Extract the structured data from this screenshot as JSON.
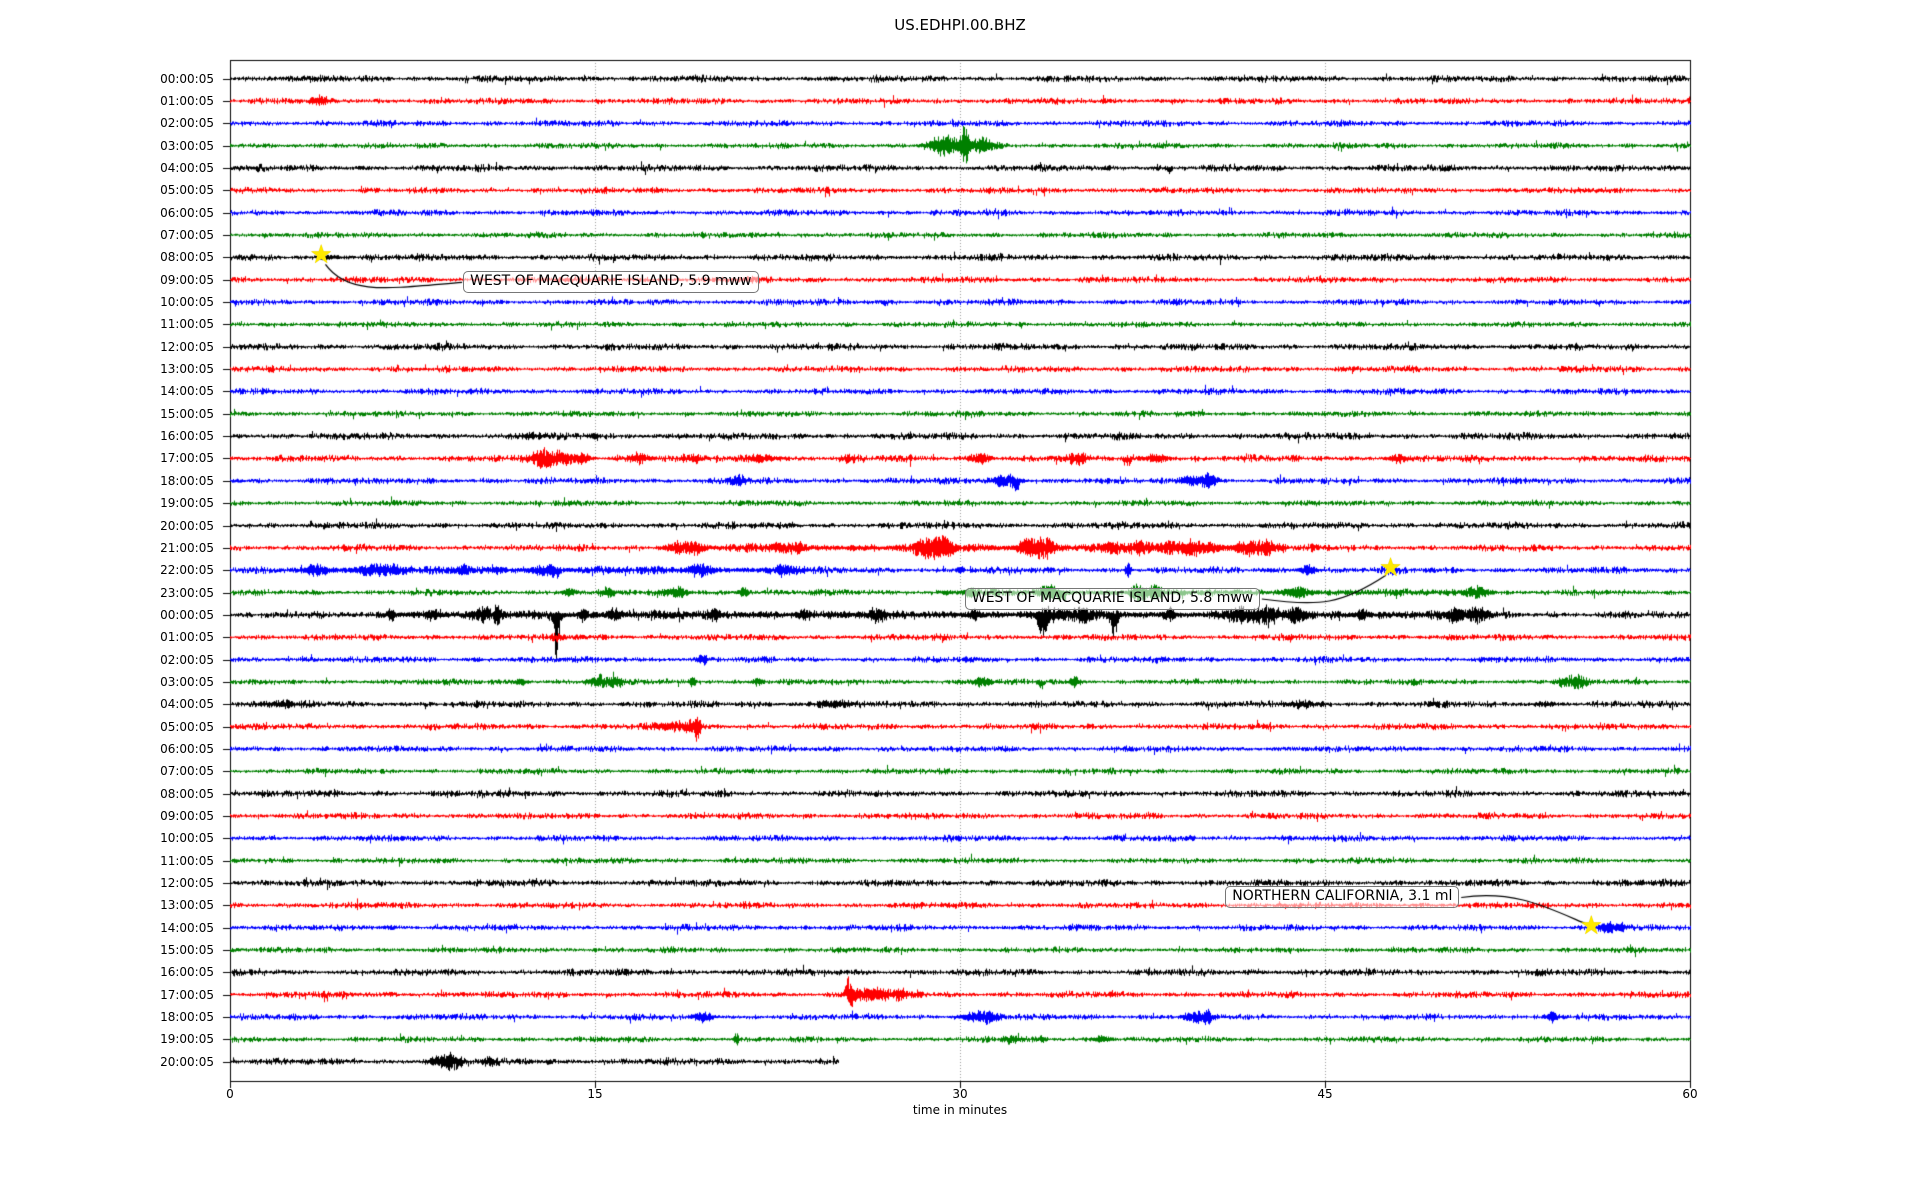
{
  "header": {
    "title": "US.EDHPI.00.BHZ"
  },
  "chart_data": {
    "type": "line",
    "subtype": "seismogram_dayplot",
    "title": "US.EDHPI.00.BHZ",
    "xlabel": "time in minutes",
    "x_axis": {
      "label": "time in minutes",
      "ticks": [
        0,
        15,
        30,
        45,
        60
      ],
      "range": [
        0,
        60
      ],
      "gridlines_at": [
        15,
        30,
        45
      ],
      "grid_style": "dotted"
    },
    "legend": "none",
    "trace_color_cycle": [
      "#000000",
      "#ff0000",
      "#0000ff",
      "#008000"
    ],
    "grid_color": "#9a9a9a",
    "marker_color": "#ffe900",
    "rows": [
      {
        "label": "00:00:05",
        "color": "#000000",
        "noise": 2.8,
        "events": []
      },
      {
        "label": "01:00:05",
        "color": "#ff0000",
        "noise": 2.6,
        "events": [
          {
            "t": 3.7,
            "d": 0.25,
            "a": 3.5
          }
        ]
      },
      {
        "label": "02:00:05",
        "color": "#0000ff",
        "noise": 2.6,
        "events": []
      },
      {
        "label": "03:00:05",
        "color": "#008000",
        "noise": 2.4,
        "events": [
          {
            "t": 29.4,
            "d": 0.45,
            "a": 9
          },
          {
            "t": 30.2,
            "d": 0.12,
            "a": 21
          },
          {
            "t": 30.9,
            "d": 0.3,
            "a": 8
          }
        ]
      },
      {
        "label": "04:00:05",
        "color": "#000000",
        "noise": 2.8,
        "events": [
          {
            "t": 38.6,
            "d": 0.06,
            "a": 8,
            "dir": -1
          }
        ]
      },
      {
        "label": "05:00:05",
        "color": "#ff0000",
        "noise": 2.6,
        "events": []
      },
      {
        "label": "06:00:05",
        "color": "#0000ff",
        "noise": 2.6,
        "events": []
      },
      {
        "label": "07:00:05",
        "color": "#008000",
        "noise": 2.4,
        "events": []
      },
      {
        "label": "08:00:05",
        "color": "#000000",
        "noise": 2.9,
        "events": [
          {
            "t": 4.1,
            "d": 0.3,
            "a": 1.5
          }
        ]
      },
      {
        "label": "09:00:05",
        "color": "#ff0000",
        "noise": 2.7,
        "events": []
      },
      {
        "label": "10:00:05",
        "color": "#0000ff",
        "noise": 2.6,
        "events": [
          {
            "t": 26.9,
            "d": 0.07,
            "a": 6,
            "dir": -1
          }
        ]
      },
      {
        "label": "11:00:05",
        "color": "#008000",
        "noise": 2.4,
        "events": []
      },
      {
        "label": "12:00:05",
        "color": "#000000",
        "noise": 2.9,
        "events": []
      },
      {
        "label": "13:00:05",
        "color": "#ff0000",
        "noise": 2.7,
        "events": []
      },
      {
        "label": "14:00:05",
        "color": "#0000ff",
        "noise": 2.6,
        "events": []
      },
      {
        "label": "15:00:05",
        "color": "#008000",
        "noise": 2.4,
        "events": []
      },
      {
        "label": "16:00:05",
        "color": "#000000",
        "noise": 3.0,
        "events": [
          {
            "t": 12.4,
            "d": 0.3,
            "a": 2
          },
          {
            "t": 15.0,
            "d": 0.1,
            "a": 4
          }
        ]
      },
      {
        "label": "17:00:05",
        "color": "#ff0000",
        "noise": 2.9,
        "events": [
          {
            "t": 12.8,
            "d": 0.35,
            "a": 8
          },
          {
            "t": 13.6,
            "d": 0.4,
            "a": 6
          },
          {
            "t": 14.5,
            "d": 0.2,
            "a": 5
          },
          {
            "t": 16.8,
            "d": 0.35,
            "a": 4
          },
          {
            "t": 19.0,
            "d": 0.3,
            "a": 3
          },
          {
            "t": 21.8,
            "d": 0.4,
            "a": 4
          },
          {
            "t": 25.4,
            "d": 0.2,
            "a": 3
          },
          {
            "t": 30.8,
            "d": 0.3,
            "a": 5
          },
          {
            "t": 34.8,
            "d": 0.3,
            "a": 4
          },
          {
            "t": 36.9,
            "d": 0.1,
            "a": 7,
            "dir": -1
          },
          {
            "t": 38.1,
            "d": 0.3,
            "a": 4
          },
          {
            "t": 48.0,
            "d": 0.25,
            "a": 4
          }
        ]
      },
      {
        "label": "18:00:05",
        "color": "#0000ff",
        "noise": 2.7,
        "events": [
          {
            "t": 20.8,
            "d": 0.25,
            "a": 5
          },
          {
            "t": 31.9,
            "d": 0.35,
            "a": 6
          },
          {
            "t": 32.3,
            "d": 0.1,
            "a": 8,
            "dir": -1
          },
          {
            "t": 39.5,
            "d": 0.3,
            "a": 5
          },
          {
            "t": 40.2,
            "d": 0.25,
            "a": 7
          }
        ]
      },
      {
        "label": "19:00:05",
        "color": "#008000",
        "noise": 2.4,
        "events": []
      },
      {
        "label": "20:00:05",
        "color": "#000000",
        "noise": 2.9,
        "events": []
      },
      {
        "label": "21:00:05",
        "color": "#ff0000",
        "noise": 2.9,
        "bands": [
          {
            "t0": 17.5,
            "t1": 43.5,
            "a": 1.2
          }
        ],
        "events": [
          {
            "t": 18.4,
            "d": 0.3,
            "a": 5
          },
          {
            "t": 19.1,
            "d": 0.2,
            "a": 4
          },
          {
            "t": 22.6,
            "d": 0.3,
            "a": 4
          },
          {
            "t": 23.3,
            "d": 0.15,
            "a": 5
          },
          {
            "t": 28.6,
            "d": 0.35,
            "a": 8
          },
          {
            "t": 29.3,
            "d": 0.3,
            "a": 10
          },
          {
            "t": 32.8,
            "d": 0.3,
            "a": 8
          },
          {
            "t": 33.5,
            "d": 0.3,
            "a": 9
          },
          {
            "t": 36.2,
            "d": 0.3,
            "a": 4
          },
          {
            "t": 37.3,
            "d": 0.35,
            "a": 5
          },
          {
            "t": 38.6,
            "d": 0.35,
            "a": 5
          },
          {
            "t": 39.5,
            "d": 0.35,
            "a": 6
          },
          {
            "t": 40.3,
            "d": 0.3,
            "a": 4
          },
          {
            "t": 41.8,
            "d": 0.35,
            "a": 6
          },
          {
            "t": 42.6,
            "d": 0.3,
            "a": 5
          }
        ]
      },
      {
        "label": "22:00:05",
        "color": "#0000ff",
        "noise": 2.8,
        "bands": [
          {
            "t0": 2.5,
            "t1": 24.0,
            "a": 1.0
          }
        ],
        "events": [
          {
            "t": 3.6,
            "d": 0.3,
            "a": 4
          },
          {
            "t": 5.8,
            "d": 0.45,
            "a": 5
          },
          {
            "t": 6.7,
            "d": 0.3,
            "a": 4
          },
          {
            "t": 9.6,
            "d": 0.2,
            "a": 4
          },
          {
            "t": 11.0,
            "d": 0.15,
            "a": 3
          },
          {
            "t": 12.9,
            "d": 0.35,
            "a": 5
          },
          {
            "t": 13.4,
            "d": 0.1,
            "a": 7,
            "dir": -1
          },
          {
            "t": 19.3,
            "d": 0.35,
            "a": 6
          },
          {
            "t": 22.8,
            "d": 0.3,
            "a": 4
          },
          {
            "t": 30.0,
            "d": 0.1,
            "a": 3
          },
          {
            "t": 36.9,
            "d": 0.08,
            "a": 9
          },
          {
            "t": 44.3,
            "d": 0.25,
            "a": 5
          },
          {
            "t": 47.8,
            "d": 0.15,
            "a": 3
          }
        ]
      },
      {
        "label": "23:00:05",
        "color": "#008000",
        "noise": 2.6,
        "bands": [
          {
            "t0": 29.0,
            "t1": 52.0,
            "a": 0.8
          }
        ],
        "events": [
          {
            "t": 13.9,
            "d": 0.2,
            "a": 4
          },
          {
            "t": 15.5,
            "d": 0.2,
            "a": 4
          },
          {
            "t": 18.3,
            "d": 0.35,
            "a": 5
          },
          {
            "t": 21.1,
            "d": 0.15,
            "a": 5
          },
          {
            "t": 30.5,
            "d": 0.2,
            "a": 4
          },
          {
            "t": 33.6,
            "d": 0.25,
            "a": 7
          },
          {
            "t": 34.2,
            "d": 0.15,
            "a": 9,
            "dir": -1
          },
          {
            "t": 37.3,
            "d": 0.25,
            "a": 8
          },
          {
            "t": 38.0,
            "d": 0.2,
            "a": 6
          },
          {
            "t": 43.9,
            "d": 0.35,
            "a": 5
          },
          {
            "t": 51.2,
            "d": 0.3,
            "a": 6
          }
        ]
      },
      {
        "label": "00:00:05",
        "color": "#000000",
        "noise": 3.1,
        "bands": [
          {
            "t0": 6.0,
            "t1": 52.0,
            "a": 1.3
          }
        ],
        "events": [
          {
            "t": 6.6,
            "d": 0.08,
            "a": 7
          },
          {
            "t": 8.3,
            "d": 0.2,
            "a": 4
          },
          {
            "t": 10.4,
            "d": 0.3,
            "a": 5
          },
          {
            "t": 11.0,
            "d": 0.1,
            "a": 8
          },
          {
            "t": 13.4,
            "d": 0.1,
            "a": 45,
            "dir": -1
          },
          {
            "t": 14.5,
            "d": 0.1,
            "a": 6
          },
          {
            "t": 15.8,
            "d": 0.2,
            "a": 5
          },
          {
            "t": 19.9,
            "d": 0.1,
            "a": 5
          },
          {
            "t": 23.6,
            "d": 0.2,
            "a": 4
          },
          {
            "t": 26.6,
            "d": 0.2,
            "a": 4
          },
          {
            "t": 30.6,
            "d": 0.15,
            "a": 5
          },
          {
            "t": 33.4,
            "d": 0.15,
            "a": 20,
            "dir": -1
          },
          {
            "t": 33.8,
            "d": 0.4,
            "a": 5
          },
          {
            "t": 35.0,
            "d": 0.3,
            "a": 6
          },
          {
            "t": 36.3,
            "d": 0.1,
            "a": 25,
            "dir": -1
          },
          {
            "t": 38.6,
            "d": 0.15,
            "a": 6
          },
          {
            "t": 41.5,
            "d": 0.4,
            "a": 6
          },
          {
            "t": 42.5,
            "d": 0.4,
            "a": 7
          },
          {
            "t": 43.8,
            "d": 0.3,
            "a": 6
          },
          {
            "t": 46.5,
            "d": 0.15,
            "a": 5
          },
          {
            "t": 50.3,
            "d": 0.3,
            "a": 5
          },
          {
            "t": 51.2,
            "d": 0.3,
            "a": 6
          }
        ]
      },
      {
        "label": "01:00:05",
        "color": "#ff0000",
        "noise": 2.7,
        "events": [
          {
            "t": 13.5,
            "d": 0.15,
            "a": 3
          }
        ]
      },
      {
        "label": "02:00:05",
        "color": "#0000ff",
        "noise": 2.6,
        "events": [
          {
            "t": 19.4,
            "d": 0.12,
            "a": 6
          }
        ]
      },
      {
        "label": "03:00:05",
        "color": "#008000",
        "noise": 2.5,
        "events": [
          {
            "t": 11.9,
            "d": 0.2,
            "a": 3
          },
          {
            "t": 15.2,
            "d": 0.3,
            "a": 6
          },
          {
            "t": 15.9,
            "d": 0.15,
            "a": 5
          },
          {
            "t": 19.0,
            "d": 0.08,
            "a": 6
          },
          {
            "t": 21.7,
            "d": 0.15,
            "a": 4
          },
          {
            "t": 30.9,
            "d": 0.25,
            "a": 4
          },
          {
            "t": 33.3,
            "d": 0.08,
            "a": 12,
            "dir": -1
          },
          {
            "t": 34.7,
            "d": 0.15,
            "a": 4
          },
          {
            "t": 54.9,
            "d": 0.3,
            "a": 4
          },
          {
            "t": 55.4,
            "d": 0.2,
            "a": 5
          }
        ]
      },
      {
        "label": "04:00:05",
        "color": "#000000",
        "noise": 2.9,
        "events": [
          {
            "t": 2.0,
            "d": 0.6,
            "a": 2.2
          },
          {
            "t": 24.8,
            "d": 0.5,
            "a": 3
          },
          {
            "t": 44.0,
            "d": 0.35,
            "a": 2.5
          },
          {
            "t": 54.0,
            "d": 0.3,
            "a": 1.5
          }
        ]
      },
      {
        "label": "05:00:05",
        "color": "#ff0000",
        "noise": 2.7,
        "events": [
          {
            "t": 18.1,
            "d": 0.5,
            "a": 3.5
          },
          {
            "t": 18.9,
            "d": 0.25,
            "a": 5
          },
          {
            "t": 19.2,
            "d": 0.07,
            "a": 15
          }
        ]
      },
      {
        "label": "06:00:05",
        "color": "#0000ff",
        "noise": 2.6,
        "events": []
      },
      {
        "label": "07:00:05",
        "color": "#008000",
        "noise": 2.4,
        "events": []
      },
      {
        "label": "08:00:05",
        "color": "#000000",
        "noise": 2.9,
        "events": []
      },
      {
        "label": "09:00:05",
        "color": "#ff0000",
        "noise": 2.7,
        "events": []
      },
      {
        "label": "10:00:05",
        "color": "#0000ff",
        "noise": 2.6,
        "events": []
      },
      {
        "label": "11:00:05",
        "color": "#008000",
        "noise": 2.4,
        "events": []
      },
      {
        "label": "12:00:05",
        "color": "#000000",
        "noise": 2.9,
        "events": []
      },
      {
        "label": "13:00:05",
        "color": "#ff0000",
        "noise": 2.7,
        "events": []
      },
      {
        "label": "14:00:05",
        "color": "#0000ff",
        "noise": 2.6,
        "events": [
          {
            "t": 56.6,
            "d": 0.25,
            "a": 6
          },
          {
            "t": 57.1,
            "d": 0.15,
            "a": 4
          }
        ]
      },
      {
        "label": "15:00:05",
        "color": "#008000",
        "noise": 2.4,
        "events": []
      },
      {
        "label": "16:00:05",
        "color": "#000000",
        "noise": 2.9,
        "events": []
      },
      {
        "label": "17:00:05",
        "color": "#ff0000",
        "noise": 2.7,
        "events": [
          {
            "t": 25.4,
            "d": 0.1,
            "a": 18,
            "dir": 1
          },
          {
            "t": 25.5,
            "d": 0.07,
            "a": 14,
            "dir": -1
          },
          {
            "t": 25.9,
            "d": 0.3,
            "a": 6
          },
          {
            "t": 26.7,
            "d": 0.3,
            "a": 5
          },
          {
            "t": 27.5,
            "d": 0.2,
            "a": 4
          },
          {
            "t": 28.2,
            "d": 0.15,
            "a": 3
          }
        ]
      },
      {
        "label": "18:00:05",
        "color": "#0000ff",
        "noise": 2.6,
        "events": [
          {
            "t": 19.4,
            "d": 0.3,
            "a": 4
          },
          {
            "t": 30.6,
            "d": 0.4,
            "a": 4
          },
          {
            "t": 31.2,
            "d": 0.3,
            "a": 4.5
          },
          {
            "t": 39.6,
            "d": 0.3,
            "a": 4
          },
          {
            "t": 40.1,
            "d": 0.2,
            "a": 5
          },
          {
            "t": 54.3,
            "d": 0.15,
            "a": 5
          }
        ]
      },
      {
        "label": "19:00:05",
        "color": "#008000",
        "noise": 2.4,
        "events": [
          {
            "t": 20.8,
            "d": 0.07,
            "a": 7
          },
          {
            "t": 32.1,
            "d": 0.25,
            "a": 3
          },
          {
            "t": 33.4,
            "d": 0.1,
            "a": 3
          },
          {
            "t": 35.8,
            "d": 0.25,
            "a": 3
          }
        ]
      },
      {
        "label": "20:00:05",
        "color": "#000000",
        "noise": 2.9,
        "end": 25,
        "events": [
          {
            "t": 8.6,
            "d": 0.3,
            "a": 5
          },
          {
            "t": 9.2,
            "d": 0.25,
            "a": 6
          },
          {
            "t": 10.6,
            "d": 0.15,
            "a": 4
          }
        ]
      }
    ],
    "annotations": [
      {
        "text": "WEST OF MACQUARIE ISLAND, 5.9 mww",
        "marker": "star",
        "star_row": 8,
        "star_minute": 3.8,
        "box_row": 9,
        "box_minute": 9.58,
        "box_dy": 2.7,
        "leader": "left"
      },
      {
        "text": "WEST OF MACQUARIE ISLAND, 5.8 mww",
        "marker": "star",
        "star_row": 22,
        "star_minute": 47.75,
        "box_row": 23,
        "box_minute": 30.2,
        "box_dy": 6.5,
        "leader": "right"
      },
      {
        "text": "NORTHERN CALIFORNIA, 3.1 ml",
        "marker": "star",
        "star_row": 38,
        "star_minute": 56.0,
        "box_row": 37,
        "box_minute": 40.9,
        "box_dy": -7.8,
        "leader": "right"
      }
    ]
  }
}
